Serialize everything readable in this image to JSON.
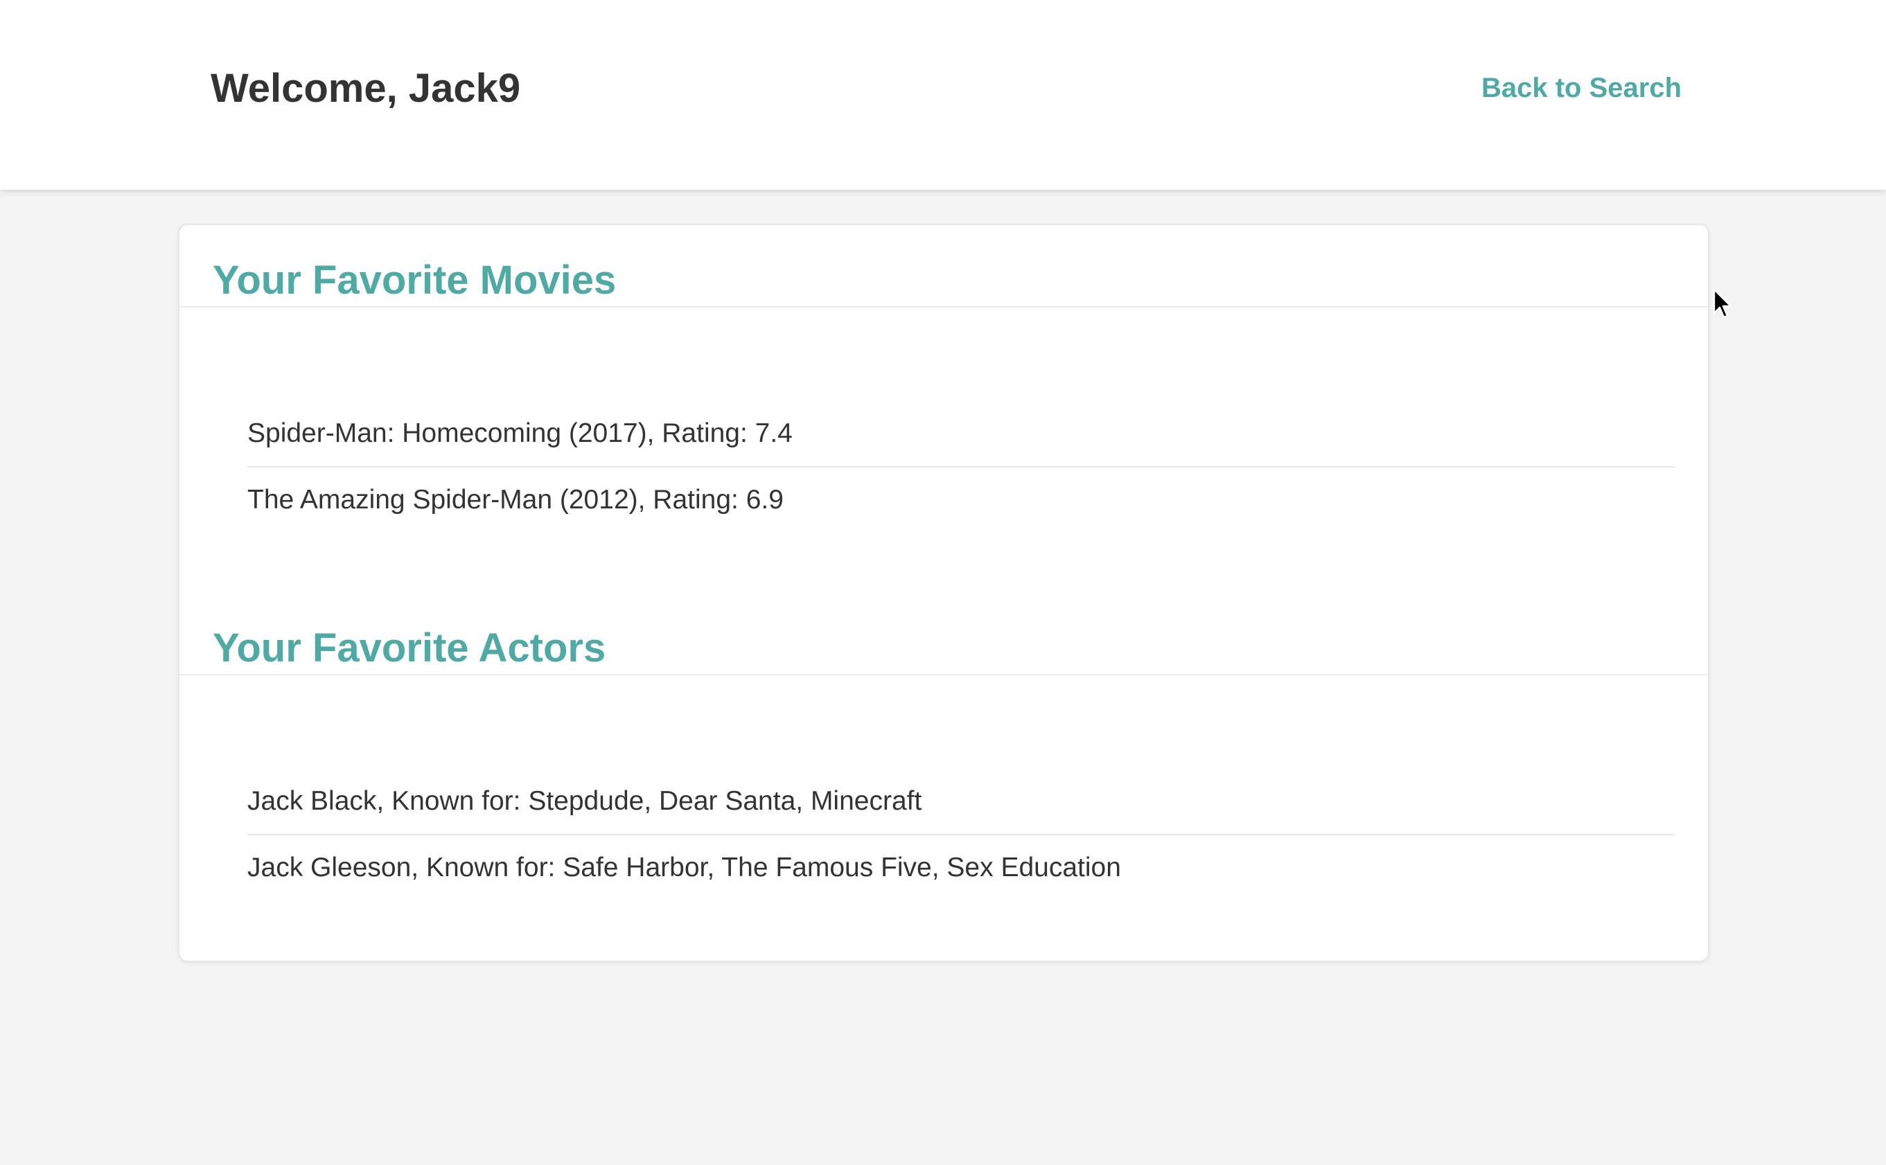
{
  "header": {
    "welcome": "Welcome, Jack9",
    "back_link": "Back to Search"
  },
  "movies": {
    "title": "Your Favorite Movies",
    "items": [
      "Spider-Man: Homecoming (2017), Rating: 7.4",
      "The Amazing Spider-Man (2012), Rating: 6.9"
    ]
  },
  "actors": {
    "title": "Your Favorite Actors",
    "items": [
      "Jack Black, Known for: Stepdude, Dear Santa, Minecraft",
      "Jack Gleeson, Known for: Safe Harbor, The Famous Five, Sex Education"
    ]
  },
  "colors": {
    "accent": "#4fa9a4",
    "text": "#333333",
    "background": "#f4f4f4"
  },
  "icons": {
    "cursor": "mouse-pointer-icon"
  }
}
